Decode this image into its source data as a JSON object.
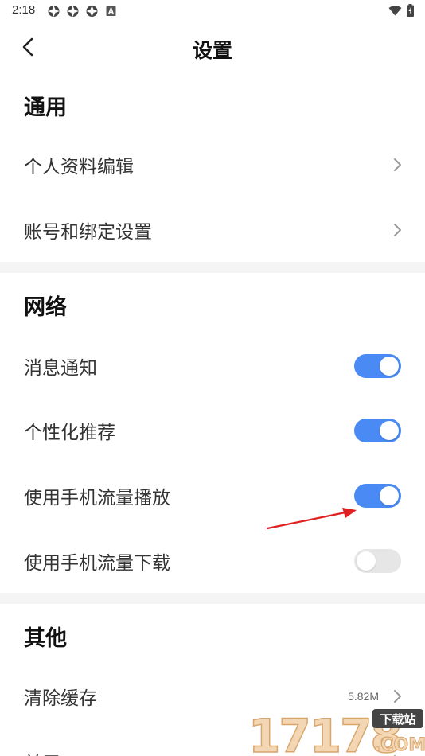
{
  "status_bar": {
    "time": "2:18",
    "notification_icons": [
      "app-icon",
      "app-icon",
      "app-icon",
      "a-icon"
    ],
    "right_icons": [
      "wifi-icon",
      "battery-icon"
    ]
  },
  "header": {
    "title": "设置",
    "back_icon": "chevron-left-icon"
  },
  "sections": {
    "general": {
      "title": "通用",
      "items": [
        {
          "label": "个人资料编辑",
          "control": "chevron"
        },
        {
          "label": "账号和绑定设置",
          "control": "chevron"
        }
      ]
    },
    "network": {
      "title": "网络",
      "items": [
        {
          "label": "消息通知",
          "control": "toggle",
          "on": true
        },
        {
          "label": "个性化推荐",
          "control": "toggle",
          "on": true
        },
        {
          "label": "使用手机流量播放",
          "control": "toggle",
          "on": true
        },
        {
          "label": "使用手机流量下载",
          "control": "toggle",
          "on": false
        }
      ]
    },
    "other": {
      "title": "其他",
      "items": [
        {
          "label": "清除缓存",
          "value": "5.82M",
          "control": "chevron"
        },
        {
          "label": "关于",
          "control": "chevron"
        }
      ]
    }
  },
  "colors": {
    "toggle_on": "#4a8af4",
    "toggle_off": "#e6e6e6",
    "section_divider": "#f4f4f4",
    "annotation_arrow": "#e02020"
  },
  "watermark": {
    "text": "17178",
    "badge": "下载站",
    "domain": ".COM"
  }
}
